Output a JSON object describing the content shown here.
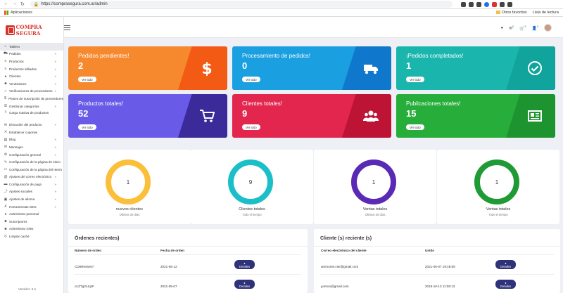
{
  "browser": {
    "url": "https://comprasegura.com.ar/admin",
    "bookmarks_label": "Aplicaciones",
    "other_favorites": "Otros favoritos",
    "reading_list": "Lista de lectura"
  },
  "brand": {
    "logo_text": "COMPRA SEGURA"
  },
  "sidebar": {
    "items": [
      {
        "label": "Tablero",
        "icon": "home-icon",
        "arrow": false,
        "active": true
      },
      {
        "label": "Pedidos",
        "icon": "cart-icon",
        "arrow": true
      },
      {
        "label": "Productos",
        "icon": "tag-icon",
        "arrow": true
      },
      {
        "label": "Productos afiliados",
        "icon": "tag-icon",
        "arrow": true
      },
      {
        "label": "Clientes",
        "icon": "user-icon",
        "arrow": true
      },
      {
        "label": "Vendedores",
        "icon": "users-icon",
        "arrow": true
      },
      {
        "label": "Verificaciones de proveedores",
        "icon": "check-icon",
        "arrow": true
      },
      {
        "label": "Planes de suscripción de proveedores",
        "icon": "dollar-icon",
        "arrow": false
      },
      {
        "label": "Gestionar categorías",
        "icon": "list-icon",
        "arrow": true
      },
      {
        "label": "Carga masiva de productos",
        "icon": "upload-icon",
        "arrow": false,
        "tall": true
      },
      {
        "label": "Discusión del producto",
        "icon": "comment-icon",
        "arrow": true
      },
      {
        "label": "Establecer cupones",
        "icon": "percent-icon",
        "arrow": false
      },
      {
        "label": "Blog",
        "icon": "blog-icon",
        "arrow": true
      },
      {
        "label": "Mensajes",
        "icon": "envelope-icon",
        "arrow": true
      },
      {
        "label": "Configuración general",
        "icon": "gear-icon",
        "arrow": true
      },
      {
        "label": "Configuración de la página de inicio",
        "icon": "edit-icon",
        "arrow": true
      },
      {
        "label": "Configuración de la página del menú",
        "icon": "file-icon",
        "arrow": true
      },
      {
        "label": "Ajustes del correo electrónico",
        "icon": "at-icon",
        "arrow": true
      },
      {
        "label": "Configuración de pago",
        "icon": "card-icon",
        "arrow": true
      },
      {
        "label": "Ajustes sociales",
        "icon": "share-icon",
        "arrow": true
      },
      {
        "label": "Ajustes de idioma",
        "icon": "language-icon",
        "arrow": true
      },
      {
        "label": "Herramientas SEO",
        "icon": "wrench-icon",
        "arrow": true
      },
      {
        "label": "Administrar personal",
        "icon": "person-icon",
        "arrow": false
      },
      {
        "label": "Suscriptores",
        "icon": "group-icon",
        "arrow": false
      },
      {
        "label": "Administrar roles",
        "icon": "roles-icon",
        "arrow": false
      },
      {
        "label": "Limpiar caché",
        "icon": "refresh-icon",
        "arrow": false
      }
    ],
    "version": "Versión: 2.1"
  },
  "header": {
    "notif_counts": [
      "0",
      "0",
      "0"
    ]
  },
  "cards": [
    {
      "title": "Pedidos pendientes!",
      "value": "2",
      "button": "Ver todo",
      "icon": "dollar-icon",
      "color": "#f6882e",
      "shade": "#f35a14"
    },
    {
      "title": "Procesamiento de pedidos!",
      "value": "0",
      "button": "Ver todo",
      "icon": "truck-icon",
      "color": "#1a9fe0",
      "shade": "#1078cc"
    },
    {
      "title": "¡Pedidos completados!",
      "value": "1",
      "button": "Ver todo",
      "icon": "check-circle-icon",
      "color": "#1ab5ad",
      "shade": "#10a49d"
    },
    {
      "title": "Productos totales!",
      "value": "52",
      "button": "Ver todo",
      "icon": "cart-icon",
      "color": "#6a5ae8",
      "shade": "#3b2a9a"
    },
    {
      "title": "Clientes totales!",
      "value": "9",
      "button": "Ver todo",
      "icon": "users-icon",
      "color": "#e2264e",
      "shade": "#bd1334"
    },
    {
      "title": "Publicaciones totales!",
      "value": "15",
      "button": "Ver todo",
      "icon": "newspaper-icon",
      "color": "#27ae3a",
      "shade": "#1e9430"
    }
  ],
  "stats": [
    {
      "value": "1",
      "label": "nuevos clientes",
      "sub": "Últimos 30 días",
      "color": "#fcbf3a"
    },
    {
      "value": "9",
      "label": "Clientes totales",
      "sub": "Todo el tiempo",
      "color": "#1bbfc7"
    },
    {
      "value": "1",
      "label": "Ventas totales",
      "sub": "Últimos 30 días",
      "color": "#5a2ab5"
    },
    {
      "value": "1",
      "label": "Ventas totales",
      "sub": "Todo el tiempo",
      "color": "#1f9a35"
    }
  ],
  "orders": {
    "title": "Órdenes recientes)",
    "headers": [
      "Número de orden",
      "Fecha de orden"
    ],
    "rows": [
      {
        "id": "CD5Rev6v07",
        "date": "2021-05-12",
        "action": "Detalles"
      },
      {
        "id": "o1ZTgGUqzF",
        "date": "2021-05-07",
        "action": "Detalles"
      }
    ]
  },
  "clients": {
    "title": "Cliente (s) reciente (s)",
    "headers": [
      "Correo electrónico del cliente",
      "Unido"
    ],
    "rows": [
      {
        "email": "ammonet.cse@gmail.com",
        "joined": "2021-05-07 19:48:59",
        "action": "Detalles"
      },
      {
        "email": "jumrun@gmail.com",
        "joined": "2019-10-13 11:59:13",
        "action": "Detalles"
      }
    ]
  }
}
